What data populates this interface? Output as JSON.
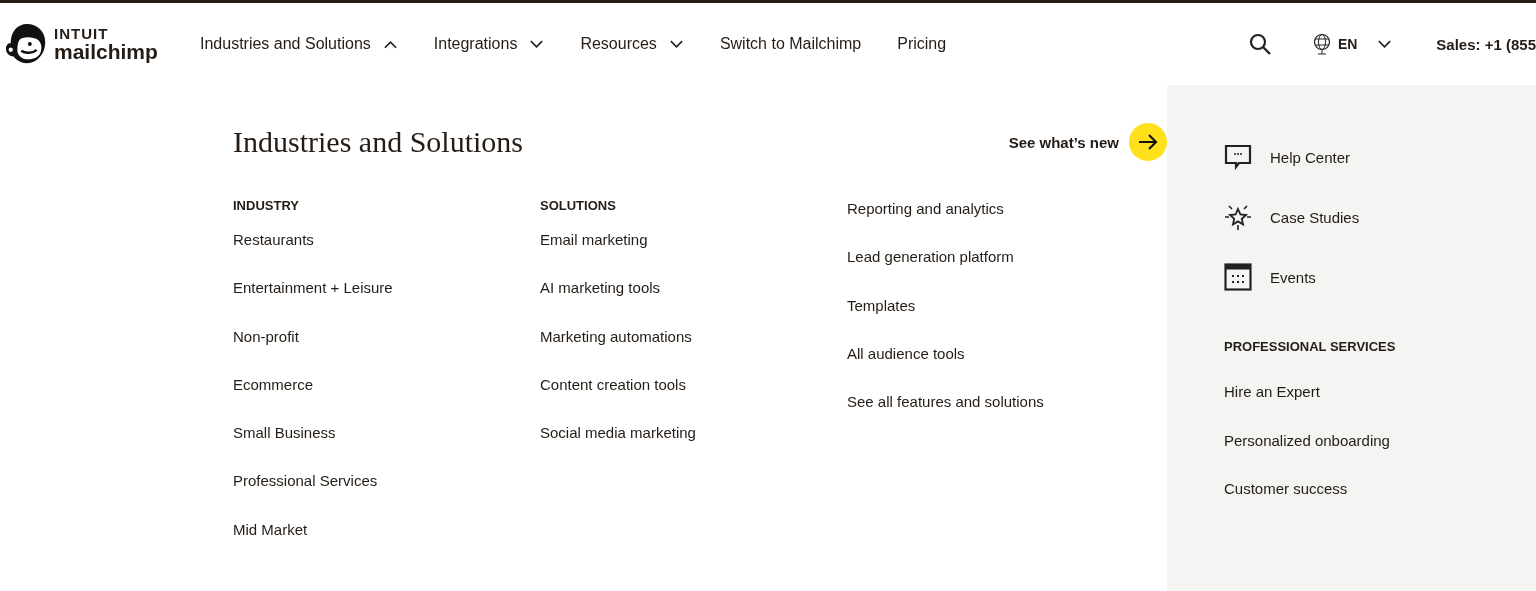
{
  "header": {
    "logo": {
      "top": "INTUIT",
      "bottom": "mailchimp"
    },
    "nav": [
      {
        "label": "Industries and Solutions",
        "kind": "menu",
        "expanded": true
      },
      {
        "label": "Integrations",
        "kind": "menu",
        "expanded": false
      },
      {
        "label": "Resources",
        "kind": "menu",
        "expanded": false
      },
      {
        "label": "Switch to Mailchimp",
        "kind": "link"
      },
      {
        "label": "Pricing",
        "kind": "link"
      }
    ],
    "language": "EN",
    "sales": "Sales: +1 (855"
  },
  "menu": {
    "title": "Industries and Solutions",
    "cta": "See what’s new",
    "columns": [
      {
        "heading": "INDUSTRY",
        "items": [
          "Restaurants",
          "Entertainment + Leisure",
          "Non-profit",
          "Ecommerce",
          "Small Business",
          "Professional Services",
          "Mid Market"
        ]
      },
      {
        "heading": "SOLUTIONS",
        "items": [
          "Email marketing",
          "AI marketing tools",
          "Marketing automations",
          "Content creation tools",
          "Social media marketing"
        ]
      },
      {
        "items": [
          "Reporting and analytics",
          "Lead generation platform",
          "Templates",
          "All audience tools",
          "See all features and solutions"
        ]
      }
    ]
  },
  "side": {
    "links": [
      {
        "label": "Help Center",
        "kind": "help"
      },
      {
        "label": "Case Studies",
        "kind": "star"
      },
      {
        "label": "Events",
        "kind": "calendar"
      }
    ],
    "heading": "PROFESSIONAL SERVICES",
    "items": [
      "Hire an Expert",
      "Personalized onboarding",
      "Customer success"
    ]
  }
}
